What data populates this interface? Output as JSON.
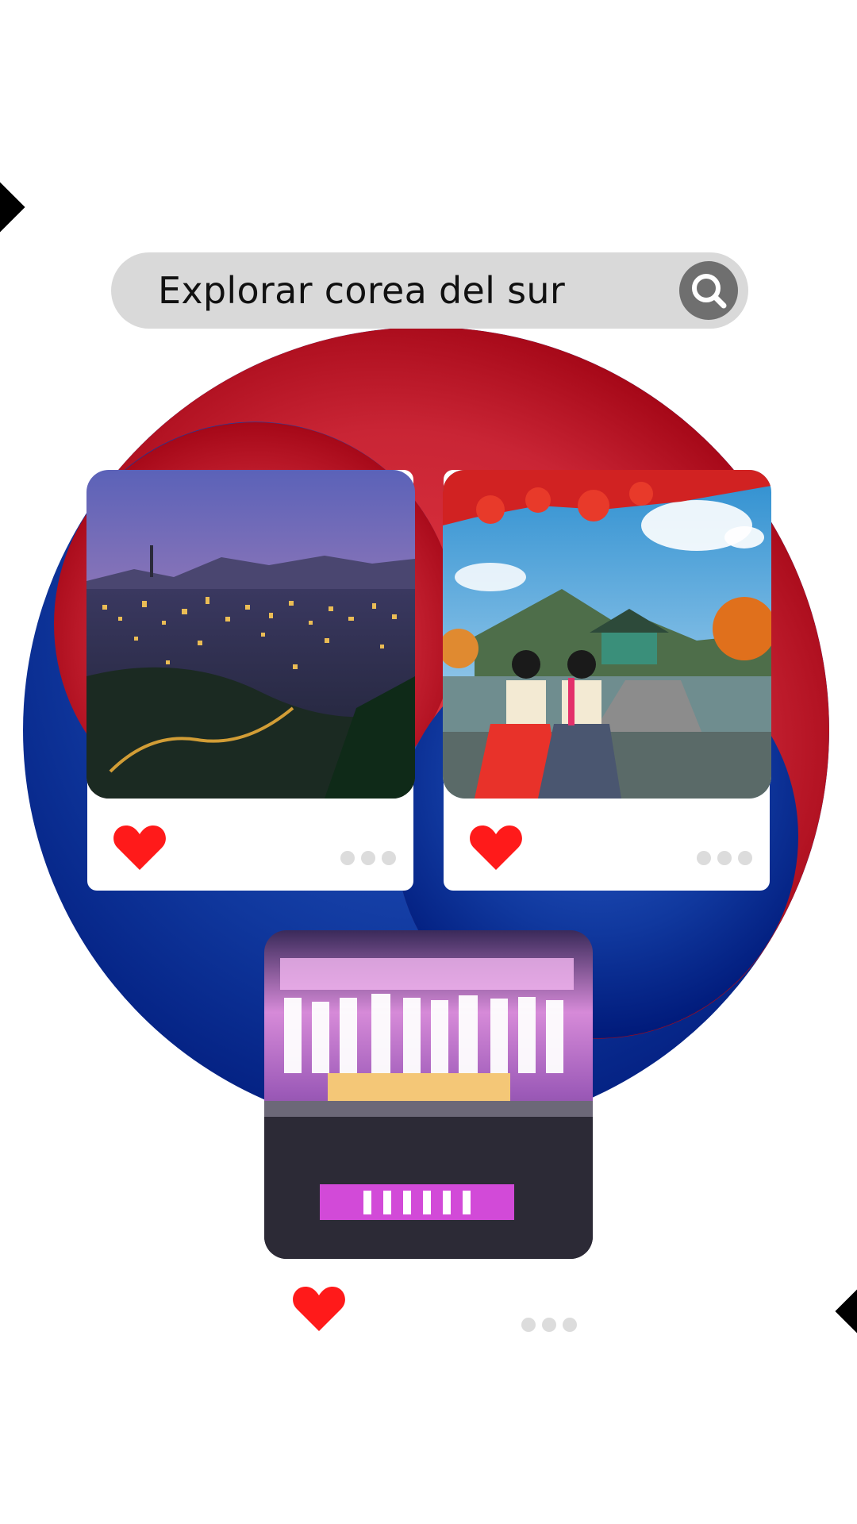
{
  "search": {
    "text": "Explorar corea del sur",
    "button_icon": "search-icon"
  },
  "colors": {
    "red": "#cd2e3a",
    "blue": "#0047a0",
    "search_bg": "#d9d9d9",
    "heart": "#ff1a1a",
    "dots": "#dcdcdc"
  },
  "cards": [
    {
      "image": "seoul-night-skyline-photo",
      "like_icon": "heart-icon",
      "more_icon": "more-dots-icon"
    },
    {
      "image": "hanbok-palace-autumn-photo",
      "like_icon": "heart-icon",
      "more_icon": "more-dots-icon"
    },
    {
      "image": "kpop-concert-stage-photo",
      "like_icon": "heart-icon",
      "more_icon": "more-dots-icon"
    }
  ]
}
